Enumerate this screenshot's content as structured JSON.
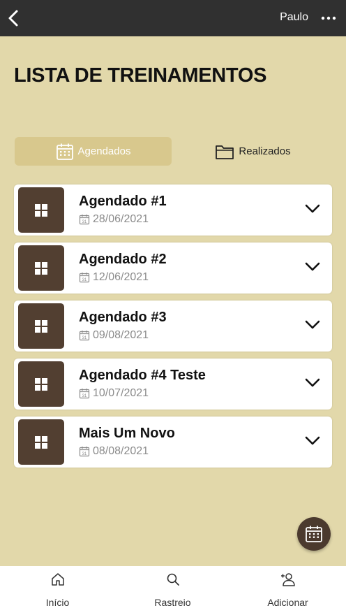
{
  "header": {
    "user_name": "Paulo"
  },
  "page": {
    "title": "LISTA DE TREINAMENTOS"
  },
  "tabs": [
    {
      "label": "Agendados",
      "icon": "calendar-icon",
      "active": true
    },
    {
      "label": "Realizados",
      "icon": "folder-icon",
      "active": false
    }
  ],
  "trainings": [
    {
      "title": "Agendado #1",
      "date": "28/06/2021"
    },
    {
      "title": "Agendado #2",
      "date": "12/06/2021"
    },
    {
      "title": "Agendado #3",
      "date": "09/08/2021"
    },
    {
      "title": "Agendado #4 Teste",
      "date": "10/07/2021"
    },
    {
      "title": "Mais Um Novo",
      "date": "08/08/2021"
    }
  ],
  "bottom_nav": [
    {
      "label": "Início",
      "icon": "home-icon"
    },
    {
      "label": "Rastreio",
      "icon": "search-icon"
    },
    {
      "label": "Adicionar",
      "icon": "add-user-icon"
    }
  ],
  "colors": {
    "background": "#e2d8aa",
    "topbar": "#303030",
    "tab_active": "#d8c88d",
    "thumb": "#523f31",
    "fab": "#4b3a2e"
  }
}
